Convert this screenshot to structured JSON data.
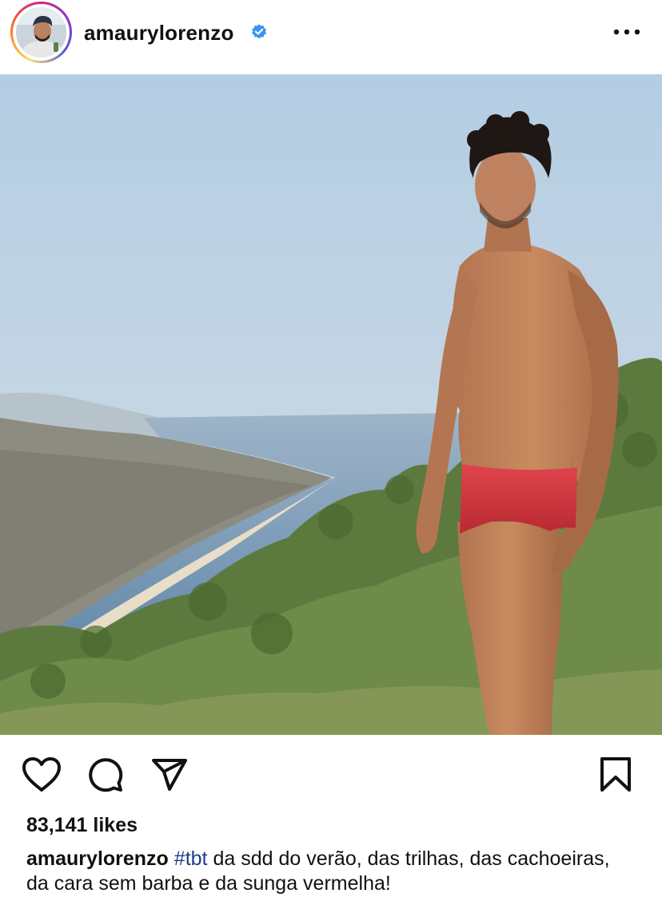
{
  "post": {
    "username": "amaurylorenzo",
    "verified": true,
    "likes": "83,141 likes",
    "caption": {
      "username": "amaurylorenzo",
      "hashtag": "#tbt",
      "text": " da sdd do verão, das trilhas, das cachoeiras, da cara sem barba e da sunga vermelha!"
    }
  },
  "icons": {
    "more": "more-horizontal-icon",
    "like": "heart-icon",
    "comment": "comment-bubble-icon",
    "share": "paper-plane-icon",
    "save": "bookmark-icon",
    "verified": "verified-badge-icon"
  },
  "colors": {
    "verified_blue": "#3897f0",
    "hashtag": "#1c3d8f",
    "text": "#111111",
    "swimsuit_red": "#d9343e"
  }
}
